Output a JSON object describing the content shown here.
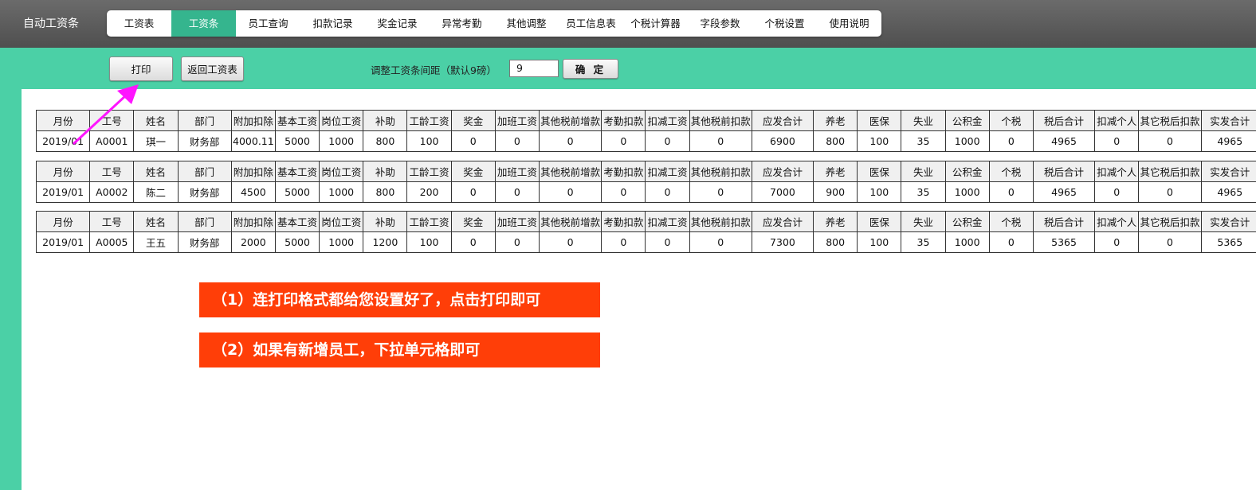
{
  "app": {
    "title": "自动工资条"
  },
  "nav": {
    "items": [
      {
        "label": "工资表"
      },
      {
        "label": "工资条",
        "active": true
      },
      {
        "label": "员工查询"
      },
      {
        "label": "扣款记录"
      },
      {
        "label": "奖金记录"
      },
      {
        "label": "异常考勤"
      },
      {
        "label": "其他调整"
      },
      {
        "label": "员工信息表"
      },
      {
        "label": "个税计算器"
      },
      {
        "label": "字段参数"
      },
      {
        "label": "个税设置"
      },
      {
        "label": "使用说明"
      }
    ]
  },
  "toolbar": {
    "print_label": "打印",
    "back_label": "返回工资表",
    "spacing_label": "调整工资条间距（默认9磅）",
    "spacing_value": "9",
    "confirm_label": "确 定"
  },
  "table": {
    "headers": [
      "月份",
      "工号",
      "姓名",
      "部门",
      "附加扣除",
      "基本工资",
      "岗位工资",
      "补助",
      "工龄工资",
      "奖金",
      "加班工资",
      "其他税前增款",
      "考勤扣款",
      "扣减工资",
      "其他税前扣款",
      "应发合计",
      "养老",
      "医保",
      "失业",
      "公积金",
      "个税",
      "税后合计",
      "扣减个人",
      "其它税后扣款",
      "实发合计"
    ],
    "rows": [
      [
        "2019/01",
        "A0001",
        "琪一",
        "财务部",
        "4000.11",
        "5000",
        "1000",
        "800",
        "100",
        "0",
        "0",
        "0",
        "0",
        "0",
        "0",
        "6900",
        "800",
        "100",
        "35",
        "1000",
        "0",
        "4965",
        "0",
        "0",
        "4965"
      ],
      [
        "2019/01",
        "A0002",
        "陈二",
        "财务部",
        "4500",
        "5000",
        "1000",
        "800",
        "200",
        "0",
        "0",
        "0",
        "0",
        "0",
        "0",
        "7000",
        "900",
        "100",
        "35",
        "1000",
        "0",
        "4965",
        "0",
        "0",
        "4965"
      ],
      [
        "2019/01",
        "A0005",
        "王五",
        "财务部",
        "2000",
        "5000",
        "1000",
        "1200",
        "100",
        "0",
        "0",
        "0",
        "0",
        "0",
        "0",
        "7300",
        "800",
        "100",
        "35",
        "1000",
        "0",
        "5365",
        "0",
        "0",
        "5365"
      ]
    ]
  },
  "notes": [
    "（1）连打印格式都给您设置好了，点击打印即可",
    "（2）如果有新增员工，下拉单元格即可"
  ],
  "colors": {
    "background": "#4bd0a6",
    "nav_active": "#35b58e",
    "note_bg": "#ff3e08",
    "arrow": "#ff14ff"
  },
  "icons": [
    "arrow-annotation"
  ]
}
